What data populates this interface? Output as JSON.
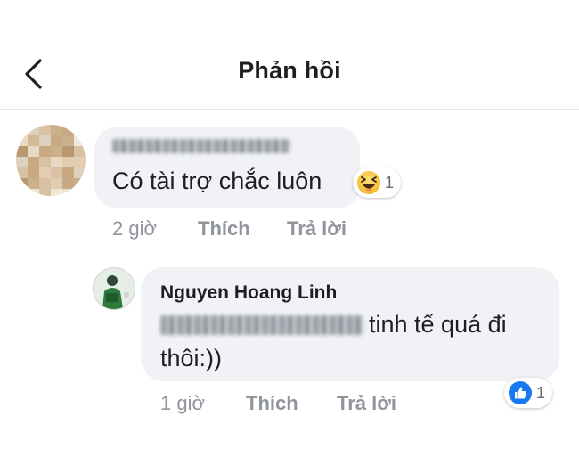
{
  "header": {
    "title": "Phản hồi"
  },
  "comment": {
    "text": "Có tài trợ chắc luôn",
    "reaction": {
      "icon": "haha-emoji-icon",
      "count": "1"
    },
    "time": "2 giờ",
    "like_label": "Thích",
    "reply_label": "Trả lời"
  },
  "reply": {
    "author": "Nguyen Hoang Linh",
    "text_line1": "tinh tế quá đi",
    "text_line2": "thôi:))",
    "reaction": {
      "icon": "like-thumb-icon",
      "count": "1"
    },
    "time": "1 giờ",
    "like_label": "Thích",
    "reply_label": "Trả lời"
  },
  "colors": {
    "bubble": "#f0f2f5",
    "like_blue": "#1877f2",
    "haha_yellow": "#f7c530",
    "meta_gray": "#90949c"
  }
}
